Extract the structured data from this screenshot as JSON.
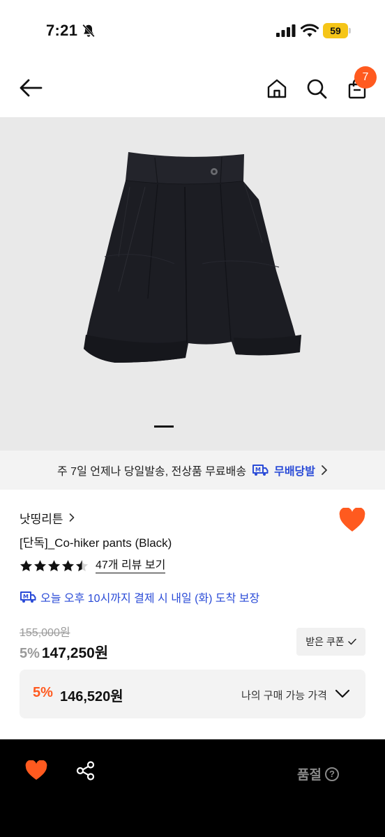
{
  "status_bar": {
    "time": "7:21",
    "battery_level": "59",
    "icons": [
      "bell-slash-icon",
      "cellular-signal-icon",
      "wifi-icon",
      "battery-icon"
    ]
  },
  "header": {
    "icons": [
      "arrow-left-icon",
      "home-icon",
      "search-icon",
      "shopping-bag-icon"
    ],
    "cart_count": "7"
  },
  "gallery": {
    "image": "black-bermuda-shorts-photo",
    "background": "#e9e9e9",
    "current_index": 1
  },
  "delivery_banner": {
    "text": "주 7일 언제나 당일발송, 전상품 무료배송",
    "badge_label": "무배당발",
    "accent_color": "#2a4bd7"
  },
  "product": {
    "brand": "낫띵리튼",
    "title": "[단독]_Co-hiker pants (Black)",
    "rating": 4.5,
    "review_link": "47개 리뷰 보기",
    "arrival_text": "오늘 오후 10시까지 결제 시 내일 (화) 도착 보장",
    "liked": true,
    "like_color": "#ff5a1f"
  },
  "pricing": {
    "original_price": "155,000원",
    "discount_rate": "5%",
    "sale_price": "147,250원",
    "coupon_button": "받은 쿠폰",
    "my_discount_rate": "5%",
    "my_price": "146,520원",
    "my_price_label": "나의 구매 가능 가격"
  },
  "bottom_bar": {
    "icons": [
      "heart-icon",
      "share-icon"
    ],
    "status_label": "품절",
    "help_glyph": "?"
  }
}
